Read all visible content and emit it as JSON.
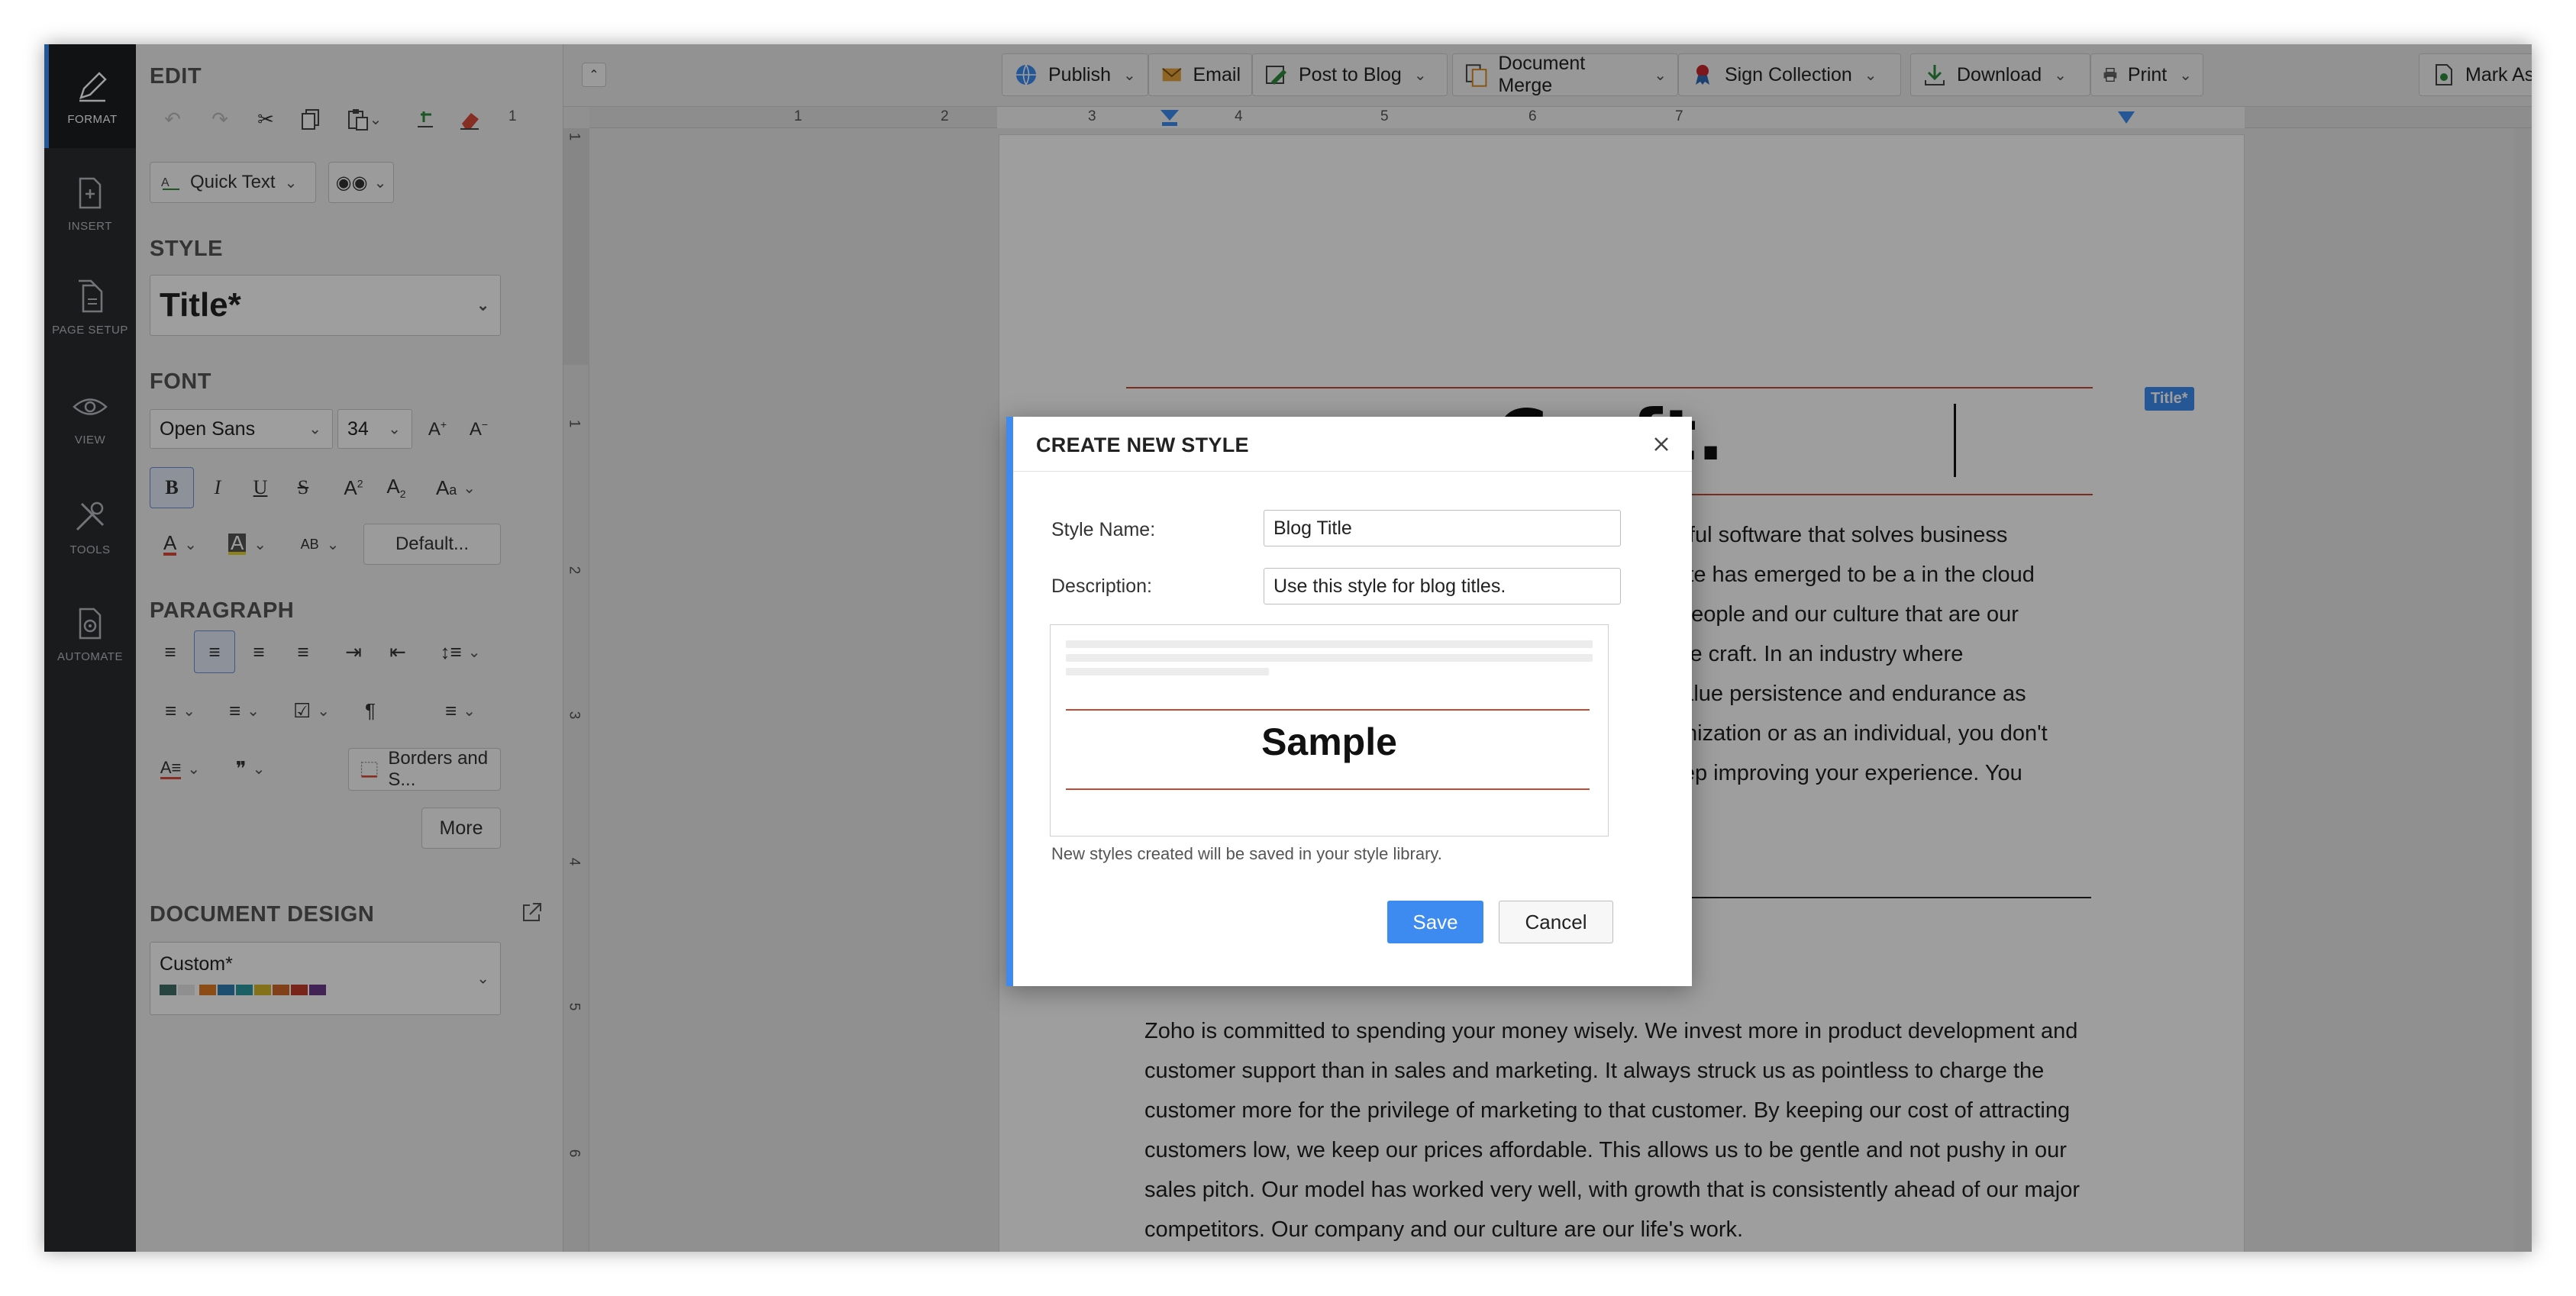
{
  "rail": {
    "items": [
      {
        "label": "FORMAT",
        "icon": "pen-icon"
      },
      {
        "label": "INSERT",
        "icon": "insert-icon"
      },
      {
        "label": "PAGE SETUP",
        "icon": "page-setup-icon"
      },
      {
        "label": "VIEW",
        "icon": "eye-icon"
      },
      {
        "label": "TOOLS",
        "icon": "tools-icon"
      },
      {
        "label": "AUTOMATE",
        "icon": "automate-icon"
      }
    ]
  },
  "panel": {
    "edit_heading": "EDIT",
    "quick_text": "Quick Text",
    "style_heading": "STYLE",
    "style_value": "Title*",
    "font_heading": "FONT",
    "font_family": "Open Sans",
    "font_size": "34",
    "default_btn": "Default...",
    "paragraph_heading": "PARAGRAPH",
    "borders_btn": "Borders and S...",
    "more_btn": "More",
    "design_heading": "DOCUMENT DESIGN",
    "design_value": "Custom*",
    "design_swatches": [
      "#3f6f6a",
      "#e7e7e7",
      "#e07b24",
      "#2f7fb3",
      "#2a9aa0",
      "#d6b92a",
      "#d0662b",
      "#c23a2b",
      "#6a3b8a"
    ]
  },
  "toolbar": {
    "publish": "Publish",
    "email": "Email",
    "post_to_blog": "Post to Blog",
    "document_merge": "Document Merge",
    "sign_collection": "Sign Collection",
    "download": "Download",
    "print": "Print",
    "mark_as": "Mark As"
  },
  "ruler": {
    "top_numbers": [
      "1",
      "1",
      "2",
      "3",
      "4",
      "5",
      "6",
      "7"
    ],
    "left_numbers": [
      "1",
      "1",
      "2",
      "3",
      "4",
      "5",
      "6"
    ]
  },
  "document": {
    "title_visible": "our Craft.",
    "style_badge": "Title*",
    "para1_lines": [
      "eautiful software that solves business",
      "o suite has emerged to be a in the cloud",
      "our people and our culture that are our",
      "ng the craft. In an industry where",
      "ve value persistence and endurance as",
      "organization or as an individual, you don't",
      "o keep improving your experience. You"
    ],
    "para2_lines": [
      "Zoho is committed to spending your money wisely. We invest more in product development and",
      "customer support than in sales and marketing. It always struck us as pointless to charge the",
      "customer more for the privilege of marketing to that customer. By keeping our cost of attracting",
      "customers low, we keep our prices affordable. This allows us to be gentle and not pushy in our",
      "sales pitch. Our model has worked very well, with growth that is consistently ahead of our major",
      "competitors. Our company and our culture are our life's work."
    ]
  },
  "dialog": {
    "title": "CREATE NEW STYLE",
    "style_name_label": "Style Name:",
    "style_name_value": "Blog Title",
    "description_label": "Description:",
    "description_value": "Use this style for blog titles.",
    "sample_text": "Sample",
    "note": "New styles created will be saved in your style library.",
    "save": "Save",
    "cancel": "Cancel"
  },
  "colors": {
    "accent": "#3d8bf0",
    "rail_bg": "#2a2c30",
    "title_rule": "#c54a33"
  }
}
